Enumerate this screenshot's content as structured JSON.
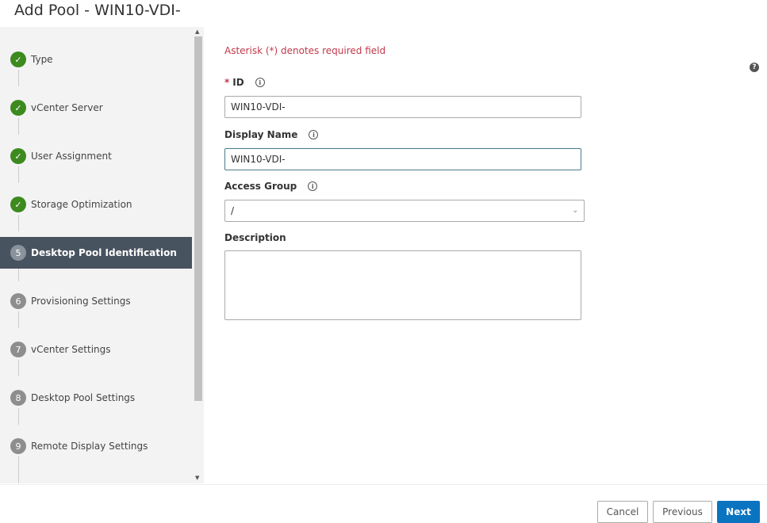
{
  "title": "Add Pool - WIN10-VDI-",
  "steps": [
    {
      "label": "Type",
      "state": "done"
    },
    {
      "label": "vCenter Server",
      "state": "done"
    },
    {
      "label": "User Assignment",
      "state": "done"
    },
    {
      "label": "Storage Optimization",
      "state": "done"
    },
    {
      "num": "5",
      "label": "Desktop Pool Identification",
      "state": "active"
    },
    {
      "num": "6",
      "label": "Provisioning Settings",
      "state": "pending"
    },
    {
      "num": "7",
      "label": "vCenter Settings",
      "state": "pending"
    },
    {
      "num": "8",
      "label": "Desktop Pool Settings",
      "state": "pending"
    },
    {
      "num": "9",
      "label": "Remote Display Settings",
      "state": "pending"
    }
  ],
  "form": {
    "required_note": "Asterisk (*) denotes required field",
    "id_label": "ID",
    "id_value": "WIN10-VDI-",
    "display_name_label": "Display Name",
    "display_name_value": "WIN10-VDI-",
    "access_group_label": "Access Group",
    "access_group_value": "/",
    "description_label": "Description",
    "description_value": ""
  },
  "buttons": {
    "cancel": "Cancel",
    "previous": "Previous",
    "next": "Next"
  },
  "colors": {
    "accent": "#0a74c0",
    "done": "#3d8a1f",
    "active_step": "#485360",
    "required": "#c0394a"
  }
}
